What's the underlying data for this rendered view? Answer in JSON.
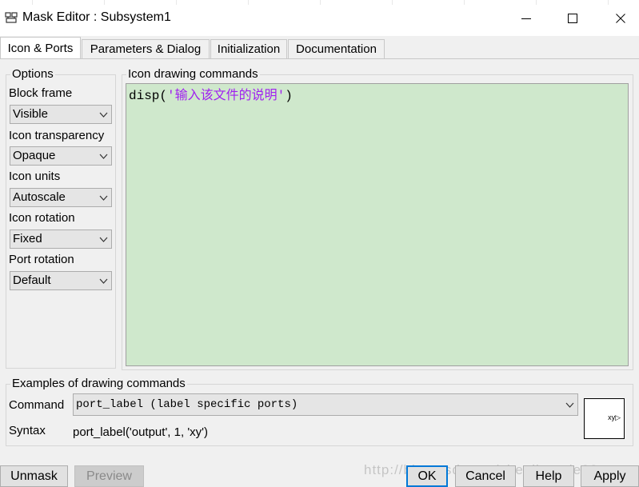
{
  "window": {
    "title": "Mask Editor : Subsystem1",
    "controls": [
      "minimize",
      "maximize",
      "close"
    ]
  },
  "tabs": [
    {
      "label": "Icon & Ports",
      "active": true
    },
    {
      "label": "Parameters & Dialog",
      "active": false
    },
    {
      "label": "Initialization",
      "active": false
    },
    {
      "label": "Documentation",
      "active": false
    }
  ],
  "options": {
    "title": "Options",
    "block_frame": {
      "label": "Block frame",
      "value": "Visible"
    },
    "icon_transparency": {
      "label": "Icon transparency",
      "value": "Opaque"
    },
    "icon_units": {
      "label": "Icon units",
      "value": "Autoscale"
    },
    "icon_rotation": {
      "label": "Icon rotation",
      "value": "Fixed"
    },
    "port_rotation": {
      "label": "Port rotation",
      "value": "Default"
    }
  },
  "drawing": {
    "title": "Icon drawing commands",
    "code_fn": "disp(",
    "code_str": "'输入该文件的说明'",
    "code_end": ")"
  },
  "examples": {
    "title": "Examples of drawing commands",
    "command_label": "Command",
    "command_value": "port_label (label specific ports)",
    "syntax_label": "Syntax",
    "syntax_value": "port_label('output', 1, 'xy')",
    "preview_port_label": "xy"
  },
  "buttons": {
    "unmask": "Unmask",
    "preview": "Preview",
    "ok": "OK",
    "cancel": "Cancel",
    "help": "Help",
    "apply": "Apply"
  },
  "watermark": "http://blog.csdn.net/chenliangde88",
  "colors": {
    "editor_bg": "#cfe8cc",
    "string_color": "#a020f0",
    "default_button_border": "#0078d7"
  },
  "icons": [
    "mask-editor-app-icon",
    "minimize-icon",
    "maximize-icon",
    "close-icon",
    "chevron-down-icon"
  ]
}
